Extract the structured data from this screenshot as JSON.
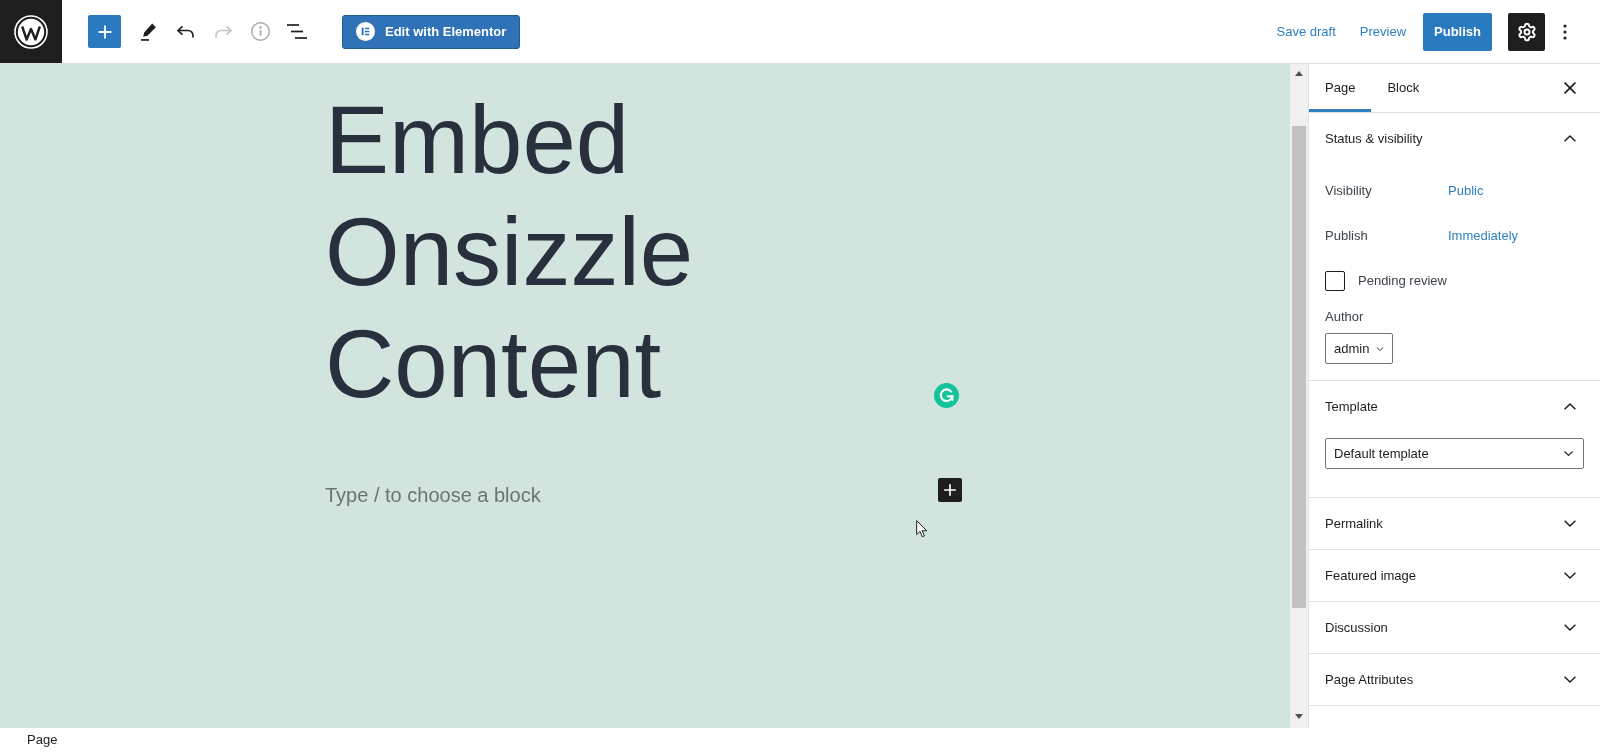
{
  "toolbar": {
    "tools": [
      {
        "kind": "inserter",
        "disabled": false
      },
      {
        "kind": "tools",
        "disabled": false
      },
      {
        "kind": "undo",
        "disabled": false
      },
      {
        "kind": "redo",
        "disabled": true
      },
      {
        "kind": "details",
        "disabled": true
      },
      {
        "kind": "list_view",
        "disabled": false
      }
    ],
    "edit_button": "Edit with Elementor",
    "actions": [
      {
        "kind": "link",
        "label": "Save draft"
      },
      {
        "kind": "link",
        "label": "Preview"
      },
      {
        "kind": "primary",
        "label": "Publish"
      }
    ],
    "settings": {
      "pressed": true
    }
  },
  "editor": {
    "title": "Embed Onsizzle Content",
    "paragraph": {
      "placeholder": "Type / to choose a block"
    }
  },
  "sidebar": {
    "tabs": [
      {
        "label": "Page",
        "selected": true
      },
      {
        "label": "Block",
        "selected": false
      }
    ],
    "panels": [
      {
        "title": "Status & visibility",
        "expanded": true,
        "rows": [
          {
            "kind": "link",
            "label": "Visibility",
            "value": "Public"
          },
          {
            "kind": "link",
            "label": "Publish",
            "value": "Immediately"
          },
          {
            "kind": "checkbox",
            "label": "Pending review",
            "checked": false
          },
          {
            "kind": "select",
            "label": "Author",
            "value": "admin"
          }
        ]
      },
      {
        "title": "Template",
        "expanded": true,
        "rows": [
          {
            "kind": "dropdown",
            "value": "Default template"
          }
        ]
      },
      {
        "title": "Permalink",
        "expanded": false
      },
      {
        "title": "Featured image",
        "expanded": false
      },
      {
        "title": "Discussion",
        "expanded": false
      },
      {
        "title": "Page Attributes",
        "expanded": false
      }
    ]
  },
  "status_bar": {
    "breadcrumb": "Page"
  }
}
